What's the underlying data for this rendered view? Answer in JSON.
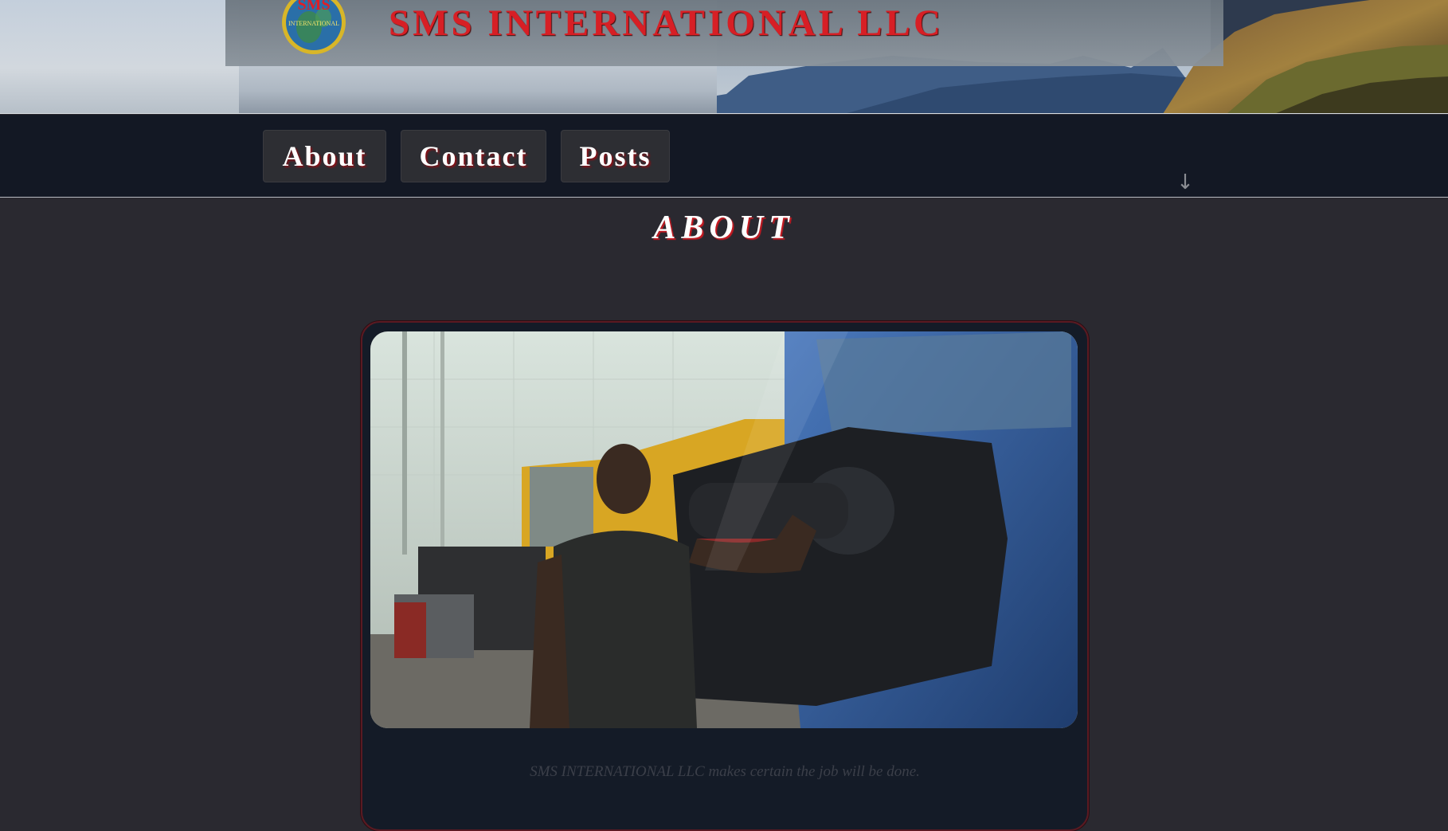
{
  "header": {
    "site_title": "SMS INTERNATIONAL LLC",
    "logo_text_top": "SMS",
    "logo_text_bottom": "INTERNATIONAL"
  },
  "nav": {
    "items": [
      {
        "label": "About"
      },
      {
        "label": "Contact"
      },
      {
        "label": "Posts"
      }
    ],
    "scroll_icon": "arrow-down-icon"
  },
  "main": {
    "heading": "ABOUT",
    "card": {
      "image_alt": "Mechanic standing beside an open truck engine in a repair shop",
      "caption": "SMS INTERNATIONAL LLC makes certain the job will be done."
    }
  },
  "colors": {
    "brand_red": "#d71f25",
    "nav_bg": "#131824",
    "page_bg": "#2a2930",
    "card_bg": "#141b27"
  }
}
